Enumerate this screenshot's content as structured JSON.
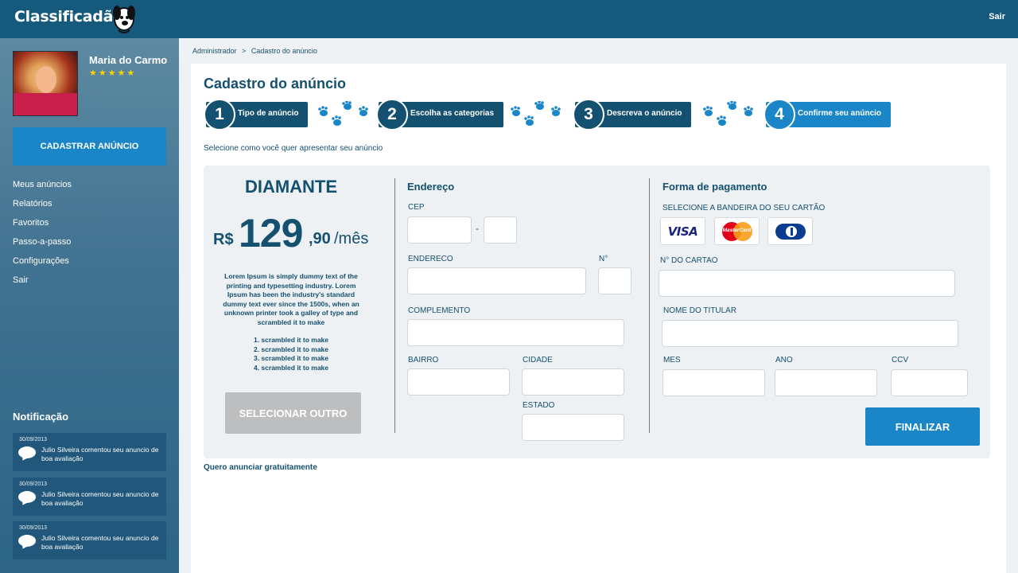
{
  "app": {
    "logo": "Classificadão",
    "logout": "Sair"
  },
  "user": {
    "name": "Maria do Carmo",
    "stars": "★★★★★"
  },
  "sidebar": {
    "cta": "CADASTRAR ANÚNCIO",
    "items": [
      {
        "label": "Meus anúncios"
      },
      {
        "label": "Relatórios"
      },
      {
        "label": "Favoritos"
      },
      {
        "label": "Passo-a-passo"
      },
      {
        "label": "Configurações"
      },
      {
        "label": "Sair"
      }
    ]
  },
  "notifications": {
    "title": "Notificação",
    "items": [
      {
        "date": "30/09/2013",
        "text": "Julio Silveira comentou seu anuncio de boa avaliação"
      },
      {
        "date": "30/09/2013",
        "text": "Julio Silveira comentou seu anuncio de boa avaliação"
      },
      {
        "date": "30/09/2013",
        "text": "Julio Silveira comentou seu anuncio de boa avaliação"
      }
    ]
  },
  "breadcrumb": [
    "Administrador",
    ">",
    "Cadastro do anúncio"
  ],
  "page": {
    "title": "Cadastro do anúncio",
    "instruction": "Selecione como você quer apresentar seu anúncio",
    "free_link": "Quero anunciar gratuitamente"
  },
  "steps": [
    {
      "num": "1",
      "label": "Tipo de anúncio",
      "active": false
    },
    {
      "num": "2",
      "label": "Escolha as categorias",
      "active": false
    },
    {
      "num": "3",
      "label": "Descreva o anúncio",
      "active": false
    },
    {
      "num": "4",
      "label": "Confirme seu anúncio",
      "active": true
    }
  ],
  "plan": {
    "name": "DIAMANTE",
    "currency": "R$",
    "price_int": "129",
    "price_cents": ",90",
    "period": "/mês",
    "description": "Lorem Ipsum is simply dummy text of the printing and typesetting industry. Lorem Ipsum has been the industry's standard dummy text ever since the 1500s, when an unknown printer took a galley of type and scrambled it to make",
    "list": [
      "1. scrambled it to make",
      "2. scrambled it to make",
      "3. scrambled it to make",
      "4. scrambled it to make"
    ],
    "select_other": "SELECIONAR OUTRO"
  },
  "address": {
    "title": "Endereço",
    "cep_label": "CEP",
    "cep_sep": "-",
    "cep_value": "",
    "cep_suffix_value": "",
    "street_label": "ENDERECO",
    "street_value": "",
    "number_label": "N°",
    "number_value": "",
    "complement_label": "COMPLEMENTO",
    "complement_value": "",
    "district_label": "BAIRRO",
    "district_value": "",
    "city_label": "CIDADE",
    "city_value": "",
    "state_label": "ESTADO",
    "state_value": ""
  },
  "payment": {
    "title": "Forma de pagamento",
    "brand_label": "SELECIONE A BANDEIRA DO SEU CARTÃO",
    "brands": [
      {
        "name": "VISA",
        "icon": "visa-logo"
      },
      {
        "name": "MasterCard",
        "icon": "mastercard-logo"
      },
      {
        "name": "Diners",
        "icon": "diners-logo"
      }
    ],
    "card_number_label": "N° DO CARTAO",
    "card_number_value": "",
    "holder_label": "NOME DO TITULAR",
    "holder_value": "",
    "month_label": "MES",
    "month_value": "",
    "year_label": "ANO",
    "year_value": "",
    "ccv_label": "CCV",
    "ccv_value": "",
    "finish": "FINALIZAR"
  },
  "colors": {
    "header": "#155a7d",
    "primary": "#1a86c8",
    "dark": "#14506f",
    "disabled": "#bcbec0",
    "panel": "#eef1f3"
  }
}
